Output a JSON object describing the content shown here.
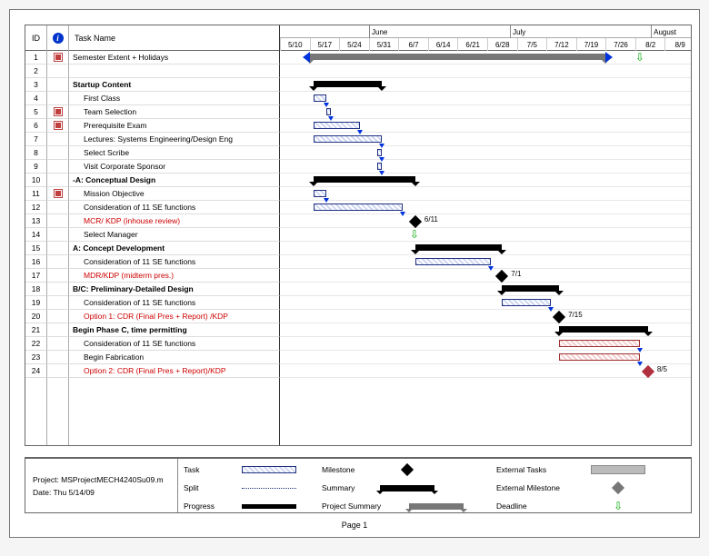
{
  "chart_data": {
    "type": "gantt",
    "title": "",
    "x_domain_start": "2009-05-10",
    "x_domain_end": "2009-08-09",
    "timeline": {
      "months": [
        {
          "label": "June",
          "pos": 0.215
        },
        {
          "label": "July",
          "pos": 0.555
        },
        {
          "label": "August",
          "pos": 0.895
        }
      ],
      "dates": [
        "5/10",
        "5/17",
        "5/24",
        "5/31",
        "6/7",
        "6/14",
        "6/21",
        "6/28",
        "7/5",
        "7/12",
        "7/19",
        "7/26",
        "8/2",
        "8/9"
      ]
    },
    "tasks": [
      {
        "id": 1,
        "name": "Semester Extent + Holidays",
        "type": "project_summary",
        "indent": 0,
        "indicator": true,
        "bold": false,
        "red": false,
        "start": "5/17",
        "end": "7/26"
      },
      {
        "id": 2,
        "name": "",
        "type": "blank",
        "indent": 0,
        "indicator": false
      },
      {
        "id": 3,
        "name": "Startup Content",
        "type": "summary",
        "indent": 0,
        "indicator": false,
        "bold": true,
        "red": false,
        "start": "5/18",
        "end": "6/3"
      },
      {
        "id": 4,
        "name": "First Class",
        "type": "task",
        "indent": 1,
        "indicator": false,
        "bold": false,
        "red": false,
        "start": "5/18",
        "end": "5/21"
      },
      {
        "id": 5,
        "name": "Team Selection",
        "type": "task",
        "indent": 1,
        "indicator": true,
        "bold": false,
        "red": false,
        "start": "5/21",
        "end": "5/22"
      },
      {
        "id": 6,
        "name": "Prerequisite Exam",
        "type": "task",
        "indent": 1,
        "indicator": true,
        "bold": false,
        "red": false,
        "start": "5/18",
        "end": "5/29"
      },
      {
        "id": 7,
        "name": "Lectures: Systems Engineering/Design Eng",
        "type": "task",
        "indent": 1,
        "indicator": false,
        "bold": false,
        "red": false,
        "start": "5/18",
        "end": "6/3"
      },
      {
        "id": 8,
        "name": "Select Scribe",
        "type": "task",
        "indent": 1,
        "indicator": false,
        "bold": false,
        "red": false,
        "start": "6/2",
        "end": "6/3"
      },
      {
        "id": 9,
        "name": "Visit Corporate Sponsor",
        "type": "task",
        "indent": 1,
        "indicator": false,
        "bold": false,
        "red": false,
        "start": "6/2",
        "end": "6/3"
      },
      {
        "id": 10,
        "name": "-A: Conceptual Design",
        "type": "summary",
        "indent": 0,
        "indicator": false,
        "bold": true,
        "red": false,
        "start": "5/18",
        "end": "6/11"
      },
      {
        "id": 11,
        "name": "Mission Objective",
        "type": "task",
        "indent": 1,
        "indicator": true,
        "bold": false,
        "red": false,
        "start": "5/18",
        "end": "5/21"
      },
      {
        "id": 12,
        "name": "Consideration of 11 SE functions",
        "type": "task",
        "indent": 1,
        "indicator": false,
        "bold": false,
        "red": false,
        "start": "5/18",
        "end": "6/8"
      },
      {
        "id": 13,
        "name": "MCR/ KDP (inhouse review)",
        "type": "milestone",
        "indent": 1,
        "indicator": false,
        "bold": false,
        "red": true,
        "date": "6/11",
        "label": "6/11"
      },
      {
        "id": 14,
        "name": "Select Manager",
        "type": "deadline",
        "indent": 1,
        "indicator": false,
        "bold": false,
        "red": false,
        "date": "6/11"
      },
      {
        "id": 15,
        "name": "A: Concept Development",
        "type": "summary",
        "indent": 0,
        "indicator": false,
        "bold": true,
        "red": false,
        "start": "6/11",
        "end": "7/1"
      },
      {
        "id": 16,
        "name": "Consideration of 11 SE functions",
        "type": "task",
        "indent": 1,
        "indicator": false,
        "bold": false,
        "red": false,
        "start": "6/11",
        "end": "6/29"
      },
      {
        "id": 17,
        "name": "MDR/KDP (midterm pres.)",
        "type": "milestone",
        "indent": 1,
        "indicator": false,
        "bold": false,
        "red": true,
        "date": "7/1",
        "label": "7/1"
      },
      {
        "id": 18,
        "name": "B/C: Preliminary-Detailed Design",
        "type": "summary",
        "indent": 0,
        "indicator": false,
        "bold": true,
        "red": false,
        "start": "7/1",
        "end": "7/15"
      },
      {
        "id": 19,
        "name": "Consideration of 11 SE functions",
        "type": "task",
        "indent": 1,
        "indicator": false,
        "bold": false,
        "red": false,
        "start": "7/1",
        "end": "7/13"
      },
      {
        "id": 20,
        "name": "Option 1: CDR (Final Pres + Report) /KDP",
        "type": "milestone",
        "indent": 1,
        "indicator": false,
        "bold": false,
        "red": true,
        "date": "7/15",
        "label": "7/15"
      },
      {
        "id": 21,
        "name": "Begin Phase C, time permitting",
        "type": "summary",
        "indent": 0,
        "indicator": false,
        "bold": true,
        "red": false,
        "start": "7/15",
        "end": "8/5"
      },
      {
        "id": 22,
        "name": "Consideration of 11 SE functions",
        "type": "task",
        "indent": 1,
        "indicator": false,
        "bold": false,
        "red": false,
        "start": "7/15",
        "end": "8/3",
        "secondary": "pink"
      },
      {
        "id": 23,
        "name": "Begin Fabrication",
        "type": "task",
        "indent": 1,
        "indicator": false,
        "bold": false,
        "red": false,
        "start": "7/15",
        "end": "8/3",
        "secondary": "pink"
      },
      {
        "id": 24,
        "name": "Option 2: CDR (Final Pres + Report)/KDP",
        "type": "milestone",
        "indent": 1,
        "indicator": false,
        "bold": false,
        "red": true,
        "date": "8/5",
        "label": "8/5",
        "pink": true
      }
    ]
  },
  "columns": {
    "id": "ID",
    "task_name": "Task Name"
  },
  "footer": {
    "project_line": "Project: MSProjectMECH4240Su09.m",
    "date_line": "Date: Thu 5/14/09",
    "page": "Page 1"
  },
  "legend": {
    "task": "Task",
    "split": "Split",
    "progress": "Progress",
    "milestone": "Milestone",
    "summary": "Summary",
    "project_summary": "Project Summary",
    "external_tasks": "External Tasks",
    "external_milestone": "External Milestone",
    "deadline": "Deadline"
  }
}
